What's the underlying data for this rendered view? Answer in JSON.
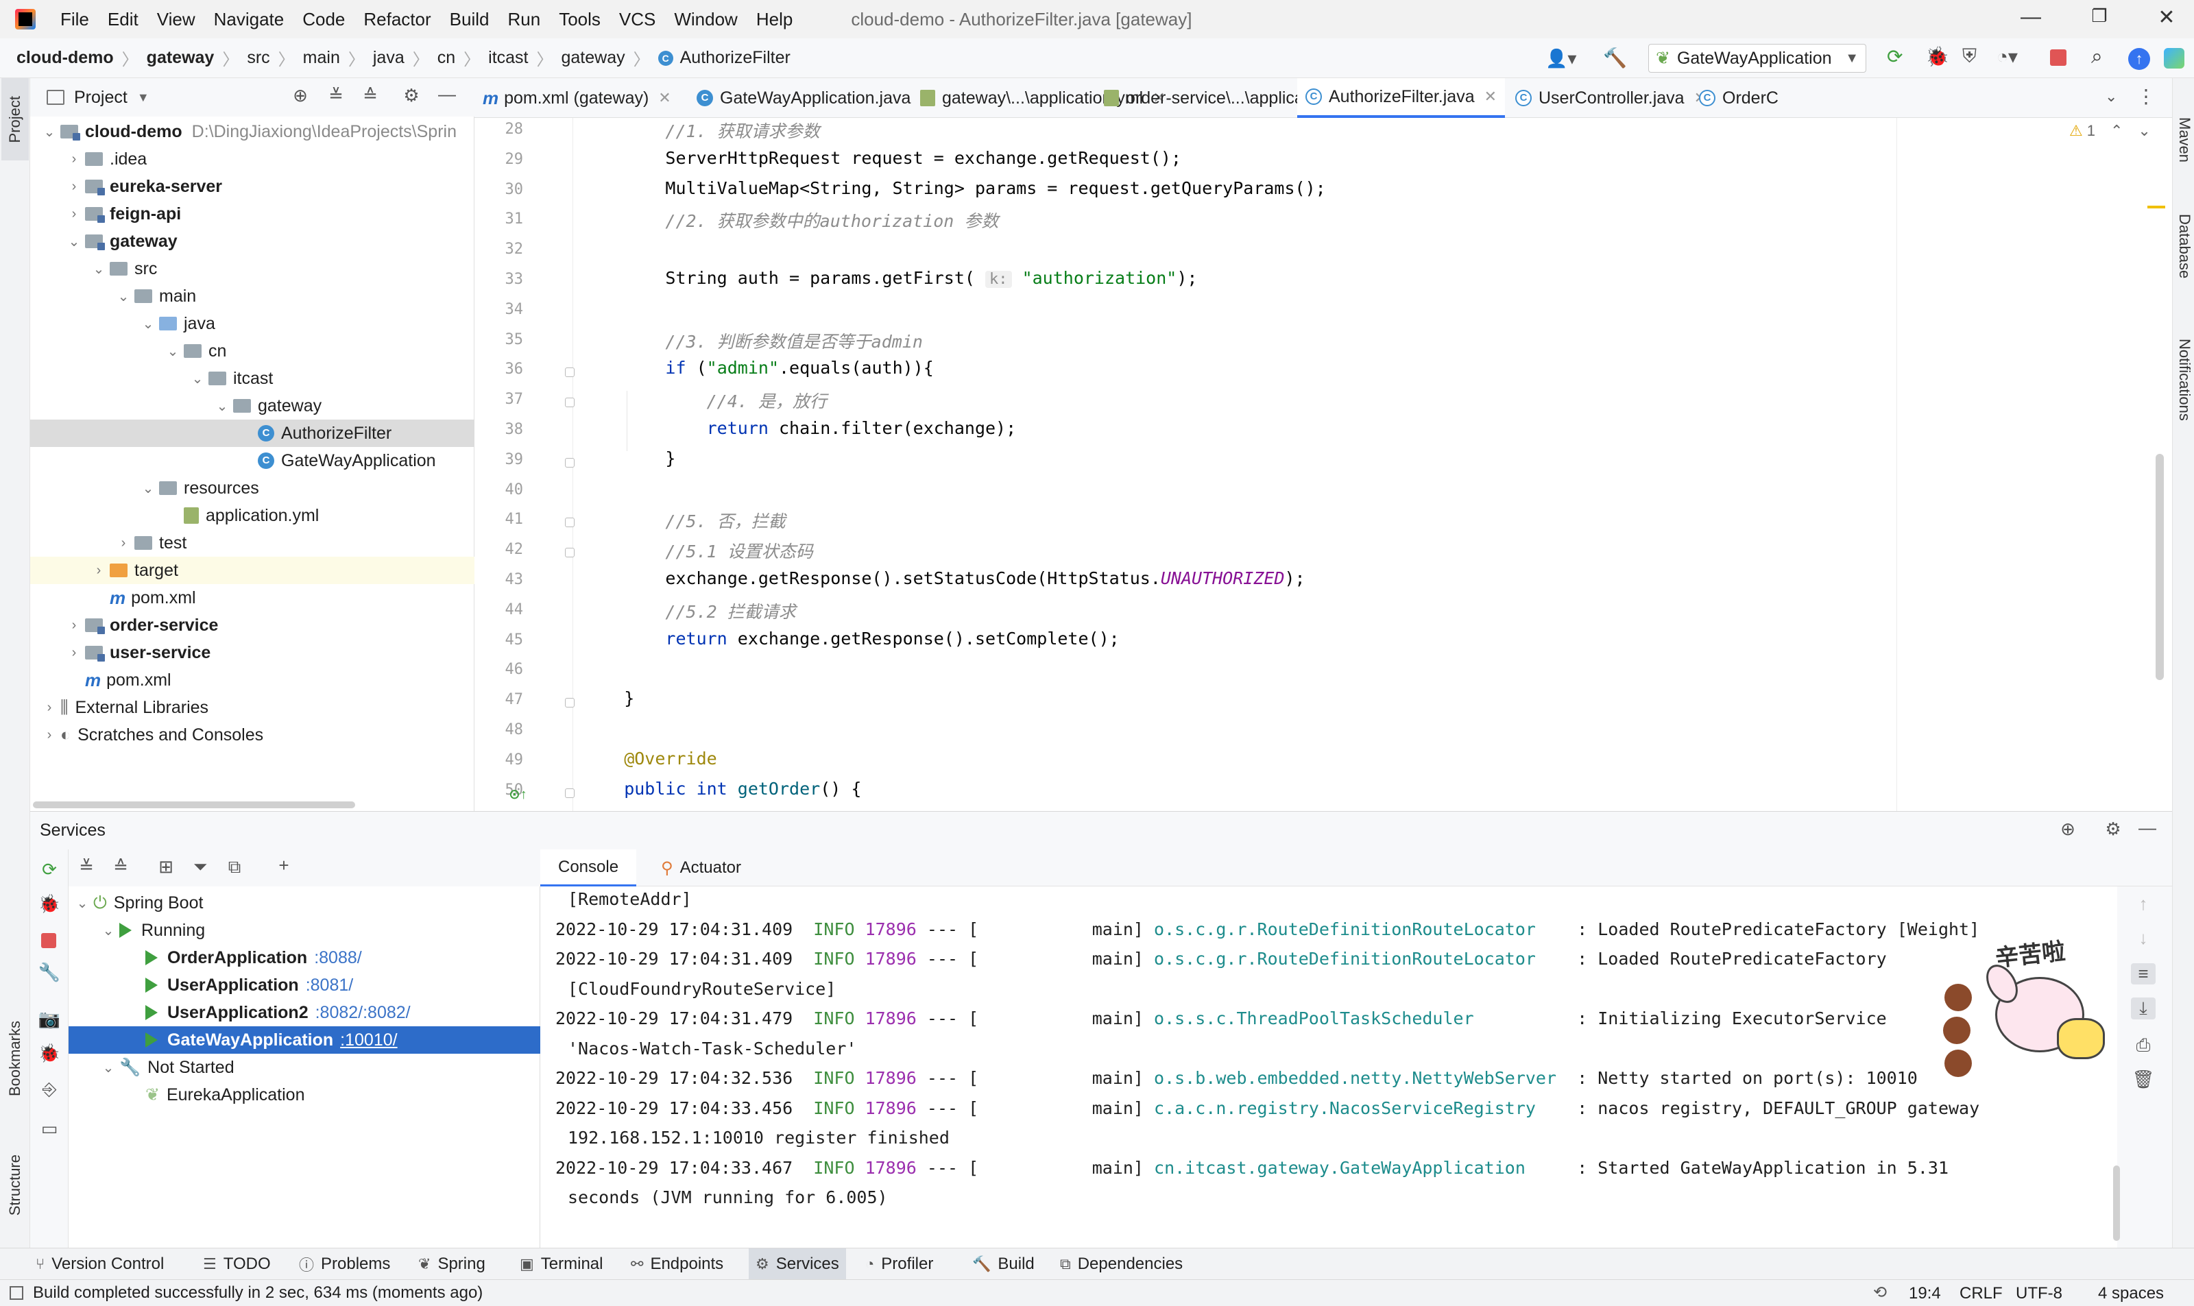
{
  "menubar": {
    "items": [
      "File",
      "Edit",
      "View",
      "Navigate",
      "Code",
      "Refactor",
      "Build",
      "Run",
      "Tools",
      "VCS",
      "Window",
      "Help"
    ],
    "window_title": "cloud-demo - AuthorizeFilter.java [gateway]"
  },
  "navbar": {
    "breadcrumbs": [
      "cloud-demo",
      "gateway",
      "src",
      "main",
      "java",
      "cn",
      "itcast",
      "gateway",
      "AuthorizeFilter"
    ],
    "run_config": "GateWayApplication"
  },
  "left_stripe": {
    "project": "Project",
    "bookmarks": "Bookmarks",
    "structure": "Structure"
  },
  "right_stripe": {
    "maven": "Maven",
    "database": "Database",
    "notifications": "Notifications"
  },
  "project_panel": {
    "title": "Project",
    "tree": [
      {
        "label": "cloud-demo",
        "path": "D:\\DingJiaxiong\\IdeaProjects\\Sprin",
        "bold": true
      },
      {
        "label": ".idea"
      },
      {
        "label": "eureka-server",
        "bold": true
      },
      {
        "label": "feign-api",
        "bold": true
      },
      {
        "label": "gateway",
        "bold": true
      },
      {
        "label": "src"
      },
      {
        "label": "main"
      },
      {
        "label": "java"
      },
      {
        "label": "cn"
      },
      {
        "label": "itcast"
      },
      {
        "label": "gateway"
      },
      {
        "label": "AuthorizeFilter"
      },
      {
        "label": "GateWayApplication"
      },
      {
        "label": "resources"
      },
      {
        "label": "application.yml"
      },
      {
        "label": "test"
      },
      {
        "label": "target"
      },
      {
        "label": "pom.xml"
      },
      {
        "label": "order-service",
        "bold": true
      },
      {
        "label": "user-service",
        "bold": true
      },
      {
        "label": "pom.xml"
      },
      {
        "label": "External Libraries"
      },
      {
        "label": "Scratches and Consoles"
      }
    ]
  },
  "editor_tabs": [
    {
      "label": "pom.xml (gateway)"
    },
    {
      "label": "GateWayApplication.java"
    },
    {
      "label": "gateway\\...\\application.yml"
    },
    {
      "label": "order-service\\...\\application.yml"
    },
    {
      "label": "AuthorizeFilter.java",
      "active": true
    },
    {
      "label": "UserController.java"
    },
    {
      "label": "OrderC"
    }
  ],
  "editor": {
    "warning_count": "1",
    "line_numbers": [
      "28",
      "29",
      "30",
      "31",
      "32",
      "33",
      "34",
      "35",
      "36",
      "37",
      "38",
      "39",
      "40",
      "41",
      "42",
      "43",
      "44",
      "45",
      "46",
      "47",
      "48",
      "49",
      "50"
    ],
    "lines": [
      {
        "parts": [
          [
            "cmt",
            "        //1. 获取请求参数"
          ]
        ]
      },
      {
        "parts": [
          [
            "",
            "        ServerHttpRequest request = exchange.getRequest();"
          ]
        ]
      },
      {
        "parts": [
          [
            "",
            "        MultiValueMap<String, String> params = request.getQueryParams();"
          ]
        ]
      },
      {
        "parts": [
          [
            "cmt",
            "        //2. 获取参数中的authorization 参数"
          ]
        ]
      },
      {
        "parts": [
          [
            "",
            ""
          ]
        ]
      },
      {
        "parts": [
          [
            "",
            "        String auth = params.getFirst( "
          ],
          [
            "hint",
            "k:"
          ],
          [
            "",
            " "
          ],
          [
            "str",
            "\"authorization\""
          ],
          [
            "",
            ");"
          ]
        ]
      },
      {
        "parts": [
          [
            "",
            ""
          ]
        ]
      },
      {
        "parts": [
          [
            "cmt",
            "        //3. 判断参数值是否等于admin"
          ]
        ]
      },
      {
        "parts": [
          [
            "kw",
            "        if "
          ],
          [
            "",
            "("
          ],
          [
            "str",
            "\"admin\""
          ],
          [
            "",
            ".equals(auth)){"
          ]
        ]
      },
      {
        "parts": [
          [
            "cmt",
            "            //4. 是，放行"
          ]
        ]
      },
      {
        "parts": [
          [
            "kw",
            "            return "
          ],
          [
            "",
            "chain.filter(exchange);"
          ]
        ]
      },
      {
        "parts": [
          [
            "",
            "        }"
          ]
        ]
      },
      {
        "parts": [
          [
            "",
            ""
          ]
        ]
      },
      {
        "parts": [
          [
            "cmt",
            "        //5. 否，拦截"
          ]
        ]
      },
      {
        "parts": [
          [
            "cmt",
            "        //5.1 设置状态码"
          ]
        ]
      },
      {
        "parts": [
          [
            "",
            "        exchange.getResponse().setStatusCode(HttpStatus."
          ],
          [
            "cst",
            "UNAUTHORIZED"
          ],
          [
            "",
            ");"
          ]
        ]
      },
      {
        "parts": [
          [
            "cmt",
            "        //5.2 拦截请求"
          ]
        ]
      },
      {
        "parts": [
          [
            "kw",
            "        return "
          ],
          [
            "",
            "exchange.getResponse().setComplete();"
          ]
        ]
      },
      {
        "parts": [
          [
            "",
            ""
          ]
        ]
      },
      {
        "parts": [
          [
            "",
            "    }"
          ]
        ]
      },
      {
        "parts": [
          [
            "",
            ""
          ]
        ]
      },
      {
        "parts": [
          [
            "ann",
            "    @Override"
          ]
        ]
      },
      {
        "parts": [
          [
            "kw",
            "    public int "
          ],
          [
            "fn",
            "getOrder"
          ],
          [
            "",
            "() {"
          ]
        ]
      }
    ]
  },
  "services": {
    "title": "Services",
    "tree": [
      {
        "label": "Spring Boot"
      },
      {
        "label": "Running"
      },
      {
        "label": "OrderApplication",
        "port": ":8088/"
      },
      {
        "label": "UserApplication",
        "port": ":8081/"
      },
      {
        "label": "UserApplication2",
        "port": ":8082/:8082/"
      },
      {
        "label": "GateWayApplication",
        "port": ":10010/",
        "selected": true
      },
      {
        "label": "Not Started"
      },
      {
        "label": "EurekaApplication"
      }
    ],
    "console_tabs": [
      "Console",
      "Actuator"
    ],
    "log": [
      {
        "cont": "[RemoteAddr]"
      },
      {
        "ts": "2022-10-29 17:04:31.409",
        "lvl": "INFO",
        "pid": "17896",
        "thread": " --- [           main] ",
        "logger": "o.s.c.g.r.RouteDefinitionRouteLocator   ",
        "msg": " : Loaded RoutePredicateFactory [Weight]"
      },
      {
        "ts": "2022-10-29 17:04:31.409",
        "lvl": "INFO",
        "pid": "17896",
        "thread": " --- [           main] ",
        "logger": "o.s.c.g.r.RouteDefinitionRouteLocator   ",
        "msg": " : Loaded RoutePredicateFactory"
      },
      {
        "cont": "[CloudFoundryRouteService]"
      },
      {
        "ts": "2022-10-29 17:04:31.479",
        "lvl": "INFO",
        "pid": "17896",
        "thread": " --- [           main] ",
        "logger": "o.s.s.c.ThreadPoolTaskScheduler         ",
        "msg": " : Initializing ExecutorService"
      },
      {
        "cont": "'Nacos-Watch-Task-Scheduler'"
      },
      {
        "ts": "2022-10-29 17:04:32.536",
        "lvl": "INFO",
        "pid": "17896",
        "thread": " --- [           main] ",
        "logger": "o.s.b.web.embedded.netty.NettyWebServer ",
        "msg": " : Netty started on port(s): 10010"
      },
      {
        "ts": "2022-10-29 17:04:33.456",
        "lvl": "INFO",
        "pid": "17896",
        "thread": " --- [           main] ",
        "logger": "c.a.c.n.registry.NacosServiceRegistry   ",
        "msg": " : nacos registry, DEFAULT_GROUP gateway"
      },
      {
        "cont": "192.168.152.1:10010 register finished"
      },
      {
        "ts": "2022-10-29 17:04:33.467",
        "lvl": "INFO",
        "pid": "17896",
        "thread": " --- [           main] ",
        "logger": "cn.itcast.gateway.GateWayApplication    ",
        "msg": " : Started GateWayApplication in 5.31"
      },
      {
        "cont": "seconds (JVM running for 6.005)"
      }
    ],
    "sticker_text": "辛苦啦"
  },
  "bottom_tabs": [
    {
      "label": "Version Control",
      "icon": "branch-icon"
    },
    {
      "label": "TODO",
      "icon": "list-icon"
    },
    {
      "label": "Problems",
      "icon": "info-icon"
    },
    {
      "label": "Spring",
      "icon": "leaf-icon"
    },
    {
      "label": "Terminal",
      "icon": "terminal-icon"
    },
    {
      "label": "Endpoints",
      "icon": "endpoints-icon"
    },
    {
      "label": "Services",
      "icon": "services-icon",
      "active": true
    },
    {
      "label": "Profiler",
      "icon": "profiler-icon"
    },
    {
      "label": "Build",
      "icon": "hammer-icon"
    },
    {
      "label": "Dependencies",
      "icon": "layers-icon"
    }
  ],
  "statusbar": {
    "message": "Build completed successfully in 2 sec, 634 ms (moments ago)",
    "position": "19:4",
    "line_sep": "CRLF",
    "encoding": "UTF-8",
    "indent": "4 spaces"
  },
  "colors": {
    "accent": "#3574f0",
    "selection": "#2d6cc9",
    "run_green": "#3f9f3f",
    "logger": "#1d8c8c"
  }
}
